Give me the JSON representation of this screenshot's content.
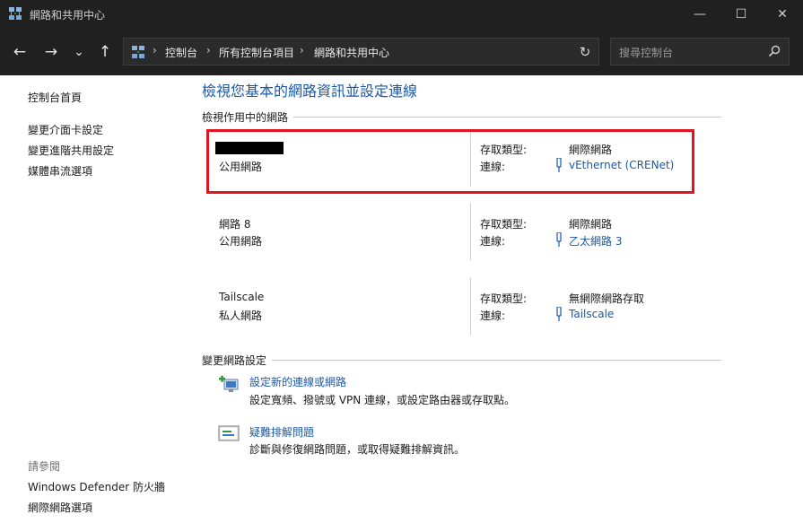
{
  "window": {
    "title": "網路和共用中心",
    "minimize_glyph": "—",
    "maximize_glyph": "☐",
    "close_glyph": "✕"
  },
  "nav": {
    "back_glyph": "←",
    "forward_glyph": "→",
    "recent_glyph": "⌄",
    "up_glyph": "↑",
    "breadcrumb": [
      "控制台",
      "所有控制台項目",
      "網路和共用中心"
    ],
    "separator": "›",
    "refresh_glyph": "↻",
    "search_placeholder": "搜尋控制台"
  },
  "sidebar": {
    "home": "控制台首頁",
    "items": [
      "變更介面卡設定",
      "變更進階共用設定",
      "媒體串流選項"
    ],
    "see_also_label": "請參閱",
    "see_also": [
      "Windows Defender 防火牆",
      "網際網路選項"
    ]
  },
  "main": {
    "title": "檢視您基本的網路資訊並設定連線",
    "active_section": "檢視作用中的網路",
    "access_label": "存取類型:",
    "connection_label": "連線:",
    "networks": [
      {
        "name": "",
        "type": "公用網路",
        "access": "網際網路",
        "connection": "vEthernet (CRENet)"
      },
      {
        "name": "網路 8",
        "type": "公用網路",
        "access": "網際網路",
        "connection": "乙太網路 3"
      },
      {
        "name": "Tailscale",
        "type": "私人網路",
        "access": "無網際網路存取",
        "connection": "Tailscale"
      }
    ],
    "change_section": "變更網路設定",
    "tasks": [
      {
        "link": "設定新的連線或網路",
        "desc": "設定寬頻、撥號或 VPN 連線，或設定路由器或存取點。",
        "icon": "new-connection-icon"
      },
      {
        "link": "疑難排解問題",
        "desc": "診斷與修復網路問題，或取得疑難排解資訊。",
        "icon": "troubleshoot-icon"
      }
    ]
  },
  "colors": {
    "titlebar": "#202020",
    "link": "#1b58a6",
    "highlight": "#e0141e"
  }
}
